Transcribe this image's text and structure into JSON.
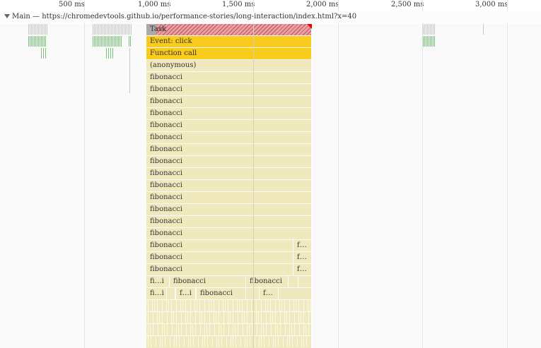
{
  "ruler": {
    "ticks": [
      "500 ms",
      "1,000 ms",
      "1,500 ms",
      "2,000 ms",
      "2,500 ms",
      "3,000 ms"
    ]
  },
  "track": {
    "title": "Main — https://chromedevtools.github.io/performance-stories/long-interaction/index.html?x=40"
  },
  "flame": {
    "task": "Task",
    "event_click": "Event: click",
    "function_call": "Function call",
    "anonymous": "(anonymous)",
    "fib": "fibonacci",
    "fib_short_f": "f…",
    "fib_short_fi": "fi…i",
    "fib_short_fdot": "f…i"
  },
  "colors": {
    "task_red": "#c45258",
    "event_yellow": "#f9cb1c",
    "js_pale": "#f1e9be"
  }
}
